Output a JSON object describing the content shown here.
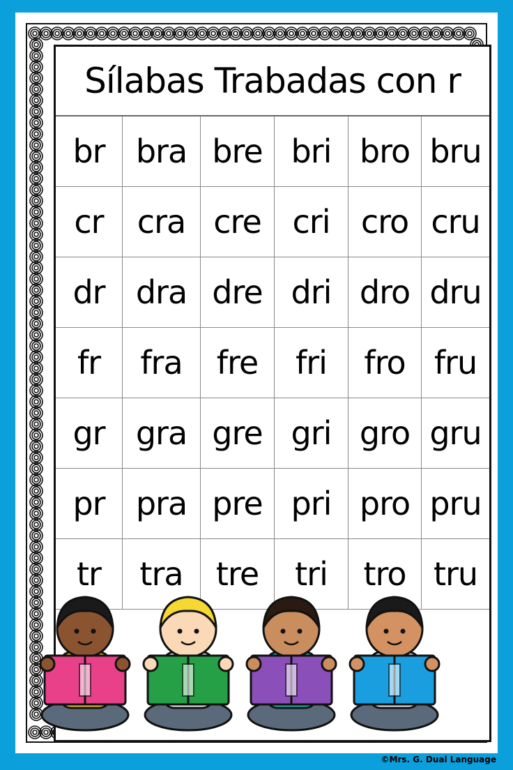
{
  "title": "Sílabas Trabadas con r",
  "rows": [
    [
      "br",
      "bra",
      "bre",
      "bri",
      "bro",
      "bru"
    ],
    [
      "cr",
      "cra",
      "cre",
      "cri",
      "cro",
      "cru"
    ],
    [
      "dr",
      "dra",
      "dre",
      "dri",
      "dro",
      "dru"
    ],
    [
      "fr",
      "fra",
      "fre",
      "fri",
      "fro",
      "fru"
    ],
    [
      "gr",
      "gra",
      "gre",
      "gri",
      "gro",
      "gru"
    ],
    [
      "pr",
      "pra",
      "pre",
      "pri",
      "pro",
      "pru"
    ],
    [
      "tr",
      "tra",
      "tre",
      "tri",
      "tro",
      "tru"
    ]
  ],
  "illustration": {
    "kids": [
      {
        "name": "girl-pink-book",
        "book_color": "#e8418a",
        "hair": "#1a1a1a",
        "skin": "#8a5430",
        "shirt": "#f0c020"
      },
      {
        "name": "boy-green-book",
        "book_color": "#25a046",
        "hair": "#f6d832",
        "skin": "#fbd9b6",
        "shirt": "#f0f0f0"
      },
      {
        "name": "girl-purple-book",
        "book_color": "#8a4fb8",
        "hair": "#2a1a12",
        "skin": "#c98d5e",
        "shirt": "#18b3b0"
      },
      {
        "name": "boy-blue-book",
        "book_color": "#1a9ee0",
        "hair": "#1a1a1a",
        "skin": "#d49262",
        "shirt": "#f0f0f0"
      }
    ]
  },
  "copyright": "©Mrs. G. Dual  Language",
  "colors": {
    "frame": "#0b9fdc",
    "ink": "#000000",
    "paper": "#ffffff"
  }
}
